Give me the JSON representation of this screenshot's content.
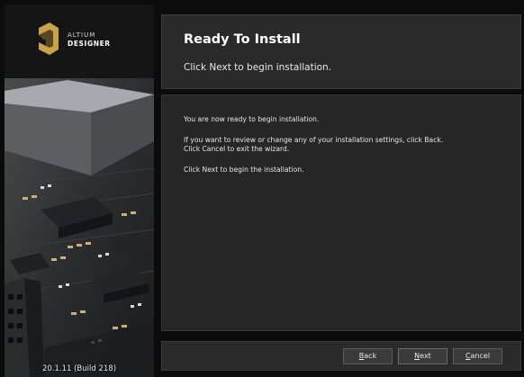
{
  "branding": {
    "logo_line1": "ALTIUM",
    "logo_line2": "DESIGNER",
    "logo_icon": "altium-a-icon",
    "accent_color": "#c9a24a",
    "version": "20.1.11 (Build 218)"
  },
  "header": {
    "title": "Ready To Install",
    "subtitle": "Click Next to begin installation."
  },
  "content": {
    "line1": "You are now ready to begin installation.",
    "line2": "If you want to review or change any of your installation settings, click Back.",
    "line3": "Click Cancel to exit the wizard.",
    "line4": "Click Next to begin the installation."
  },
  "buttons": {
    "back": {
      "accel": "B",
      "rest": "ack"
    },
    "next": {
      "accel": "N",
      "rest": "ext"
    },
    "cancel": {
      "accel": "C",
      "rest": "ancel"
    }
  }
}
